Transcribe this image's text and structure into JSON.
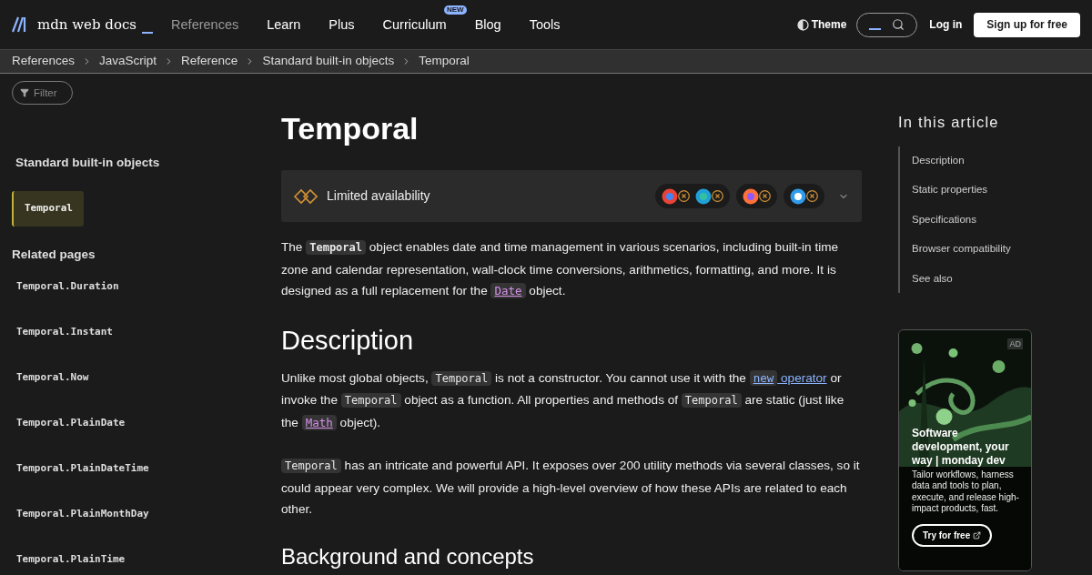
{
  "header": {
    "logo": "mdn web docs",
    "nav": [
      {
        "label": "References",
        "selected": true
      },
      {
        "label": "Learn",
        "selected": false
      },
      {
        "label": "Plus",
        "selected": false
      },
      {
        "label": "Curriculum",
        "selected": false,
        "badge": "NEW"
      },
      {
        "label": "Blog",
        "selected": false
      },
      {
        "label": "Tools",
        "selected": false
      }
    ],
    "theme": "Theme",
    "login": "Log in",
    "signup": "Sign up for free"
  },
  "breadcrumbs": [
    "References",
    "JavaScript",
    "Reference",
    "Standard built-in objects",
    "Temporal"
  ],
  "sidebar": {
    "filter": {
      "placeholder": "Filter"
    },
    "section": "Standard built-in objects",
    "items": [
      {
        "label": "Temporal",
        "selected": true
      }
    ],
    "related_title": "Related pages",
    "related": [
      {
        "label": "Temporal.Duration",
        "selected": false
      },
      {
        "label": "Temporal.Instant",
        "selected": false
      },
      {
        "label": "Temporal.Now",
        "selected": false
      },
      {
        "label": "Temporal.PlainDate",
        "selected": false
      },
      {
        "label": "Temporal.PlainDateTime",
        "selected": false
      },
      {
        "label": "Temporal.PlainMonthDay",
        "selected": false
      },
      {
        "label": "Temporal.PlainTime",
        "selected": false
      }
    ]
  },
  "article": {
    "title": "Temporal",
    "availability": {
      "label": "Limited availability"
    },
    "blocks": [
      {
        "kind": "paragraph",
        "parts": [
          {
            "kind": "text",
            "text": "The "
          },
          {
            "kind": "code_strong",
            "text": "Temporal"
          },
          {
            "kind": "text",
            "text": " object enables date and time management in various scenarios, including built-in time zone and calendar representation, wall-clock time conversions, arithmetics, formatting, and more. It is designed as a full replacement for the "
          },
          {
            "kind": "code_link",
            "text": "Date"
          },
          {
            "kind": "text",
            "text": " object."
          }
        ]
      },
      {
        "kind": "heading",
        "text": "Description"
      },
      {
        "kind": "paragraph",
        "parts": [
          {
            "kind": "text",
            "text": "Unlike most global objects, "
          },
          {
            "kind": "code",
            "text": "Temporal"
          },
          {
            "kind": "text",
            "text": " is not a constructor. You cannot use it with the "
          },
          {
            "kind": "op_link",
            "code": "new",
            "text": " operator"
          },
          {
            "kind": "text",
            "text": " or invoke the "
          },
          {
            "kind": "code",
            "text": "Temporal"
          },
          {
            "kind": "text",
            "text": " object as a function. All properties and methods of "
          },
          {
            "kind": "code",
            "text": "Temporal"
          },
          {
            "kind": "text",
            "text": " are static (just like the "
          },
          {
            "kind": "code_link",
            "text": "Math"
          },
          {
            "kind": "text",
            "text": " object)."
          }
        ]
      },
      {
        "kind": "paragraph",
        "parts": [
          {
            "kind": "code",
            "text": "Temporal"
          },
          {
            "kind": "text",
            "text": " has an intricate and powerful API. It exposes over 200 utility methods via several classes, so it could appear very complex. We will provide a high-level overview of how these APIs are related to each other."
          }
        ]
      },
      {
        "kind": "subheading",
        "text": "Background and concepts"
      }
    ]
  },
  "toc": {
    "title": "In this article",
    "items": [
      {
        "label": "Description",
        "selected": false
      },
      {
        "label": "Static properties",
        "selected": false
      },
      {
        "label": "Specifications",
        "selected": false
      },
      {
        "label": "Browser compatibility",
        "selected": false
      },
      {
        "label": "See also",
        "selected": false
      }
    ]
  },
  "ad": {
    "badge": "AD",
    "title": "Software development, your way | monday dev",
    "body": "Tailor workflows, harness data and tools to plan, execute, and release high-impact products, fast.",
    "button": "Try for free"
  }
}
